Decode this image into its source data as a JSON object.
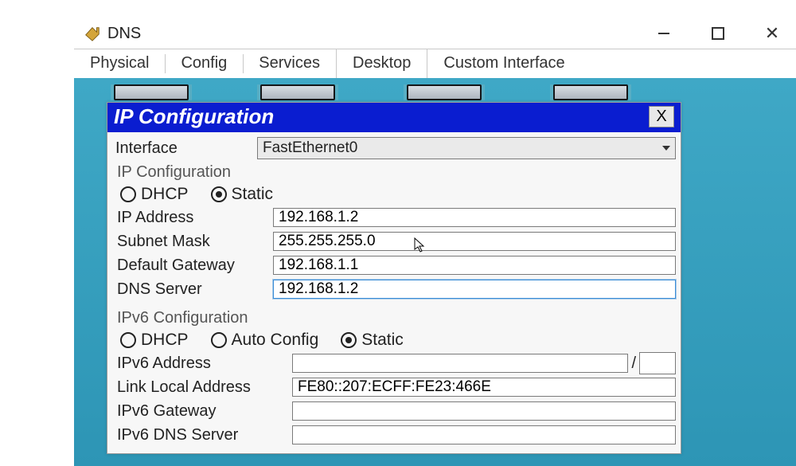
{
  "window": {
    "title": "DNS"
  },
  "tabs": [
    "Physical",
    "Config",
    "Services",
    "Desktop",
    "Custom Interface"
  ],
  "selected_tab_index": 3,
  "dialog": {
    "title": "IP Configuration",
    "close_label": "X",
    "interface_label": "Interface",
    "interface_value": "FastEthernet0",
    "ipv4": {
      "section_title": "IP Configuration",
      "radio_dhcp": "DHCP",
      "radio_static": "Static",
      "selected": "static",
      "ip_label": "IP Address",
      "ip_value": "192.168.1.2",
      "mask_label": "Subnet Mask",
      "mask_value": "255.255.255.0",
      "gw_label": "Default Gateway",
      "gw_value": "192.168.1.1",
      "dns_label": "DNS Server",
      "dns_value": "192.168.1.2"
    },
    "ipv6": {
      "section_title": "IPv6 Configuration",
      "radio_dhcp": "DHCP",
      "radio_auto": "Auto Config",
      "radio_static": "Static",
      "selected": "static",
      "addr_label": "IPv6 Address",
      "addr_value": "",
      "ll_label": "Link Local Address",
      "ll_value": "FE80::207:ECFF:FE23:466E",
      "gw_label": "IPv6 Gateway",
      "gw_value": "",
      "dns_label": "IPv6 DNS Server",
      "dns_value": "",
      "prefix_sep": "/"
    }
  }
}
